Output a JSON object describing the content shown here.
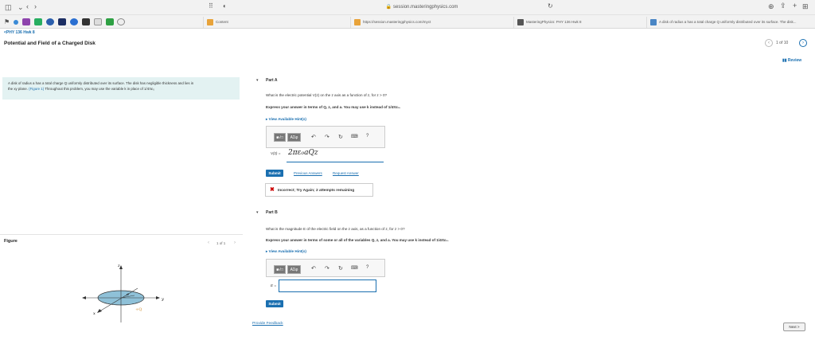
{
  "browser": {
    "url": "session.masteringphysics.com",
    "tabs": [
      {
        "label": "Content",
        "color": "#e8a33a"
      },
      {
        "label": "https://session.masteringphysics.com/myct",
        "color": "#e8a33a"
      },
      {
        "label": "MasteringPhysics: PHY 136 Hwk 8",
        "color": "#555555"
      },
      {
        "label": "A disk of radius a has a total charge Q uniformly distributed over its surface. The disk...",
        "color": "#4a86c5"
      }
    ]
  },
  "breadcrumb": "<PHY 136 Hwk 8",
  "page_title": "Potential and Field of a Charged Disk",
  "pager": {
    "text": "1 of 10"
  },
  "review_label": "Review",
  "problem": {
    "text_1": "A disk of radius a has a total charge Q uniformly distributed over its surface. The disk has negligible thickness and lies in",
    "text_2": "the xy plane.",
    "figure_link": "(Figure 1)",
    "text_3": "Throughout this problem, you may use the variable k in place of",
    "frac": "1/4πε₀"
  },
  "part_a": {
    "label": "Part A",
    "question": "What is the electric potential V(z) on the z axis as a function of z, for z > 0?",
    "instruction": "Express your answer in terms of Q, z, and a. You may use k instead of 1/4πε₀.",
    "hints": "View Available Hint(s)",
    "answer_prefix": "V(z) =",
    "answer_value": "2πε₀aQz",
    "submit": "Submit",
    "prev_answers": "Previous Answers",
    "request_answer": "Request Answer",
    "feedback": "Incorrect; Try Again; 2 attempts remaining"
  },
  "part_b": {
    "label": "Part B",
    "question": "What is the magnitude E of the electric field on the z axis, as a function of z, for z > 0?",
    "instruction": "Express your answer in terms of some or all of the variables Q, z, and a. You may use k instead of 1/4πε₀.",
    "hints": "View Available Hint(s)",
    "answer_prefix": "E =",
    "submit": "Submit"
  },
  "toolbar": {
    "btn1": "■√□",
    "btn2": "ΑΣφ",
    "btn3": "ΑΣφ",
    "help": "?"
  },
  "figure": {
    "label": "Figure",
    "pager": "1 of 1",
    "axis_z": "z",
    "axis_y": "y",
    "axis_x": "x",
    "radius": "a",
    "charge": "+Q"
  },
  "feedback_link": "Provide Feedback",
  "next_button": "Next >"
}
